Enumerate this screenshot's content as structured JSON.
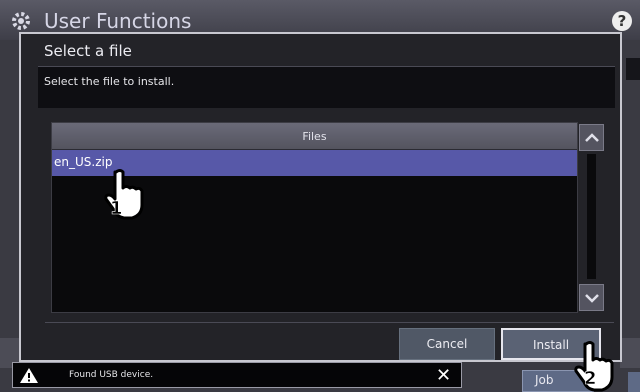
{
  "app": {
    "title": "User Functions",
    "help_label": "?"
  },
  "dialog": {
    "title": "Select a file",
    "message": "Select the file to install.",
    "list": {
      "column_header": "Files",
      "files": [
        "en_US.zip"
      ],
      "selected_index": 0
    },
    "cancel_label": "Cancel",
    "install_label": "Install"
  },
  "notification": {
    "text": "Found USB device.",
    "close_label": "✕"
  },
  "background": {
    "job_button_label": "Job"
  },
  "callouts": {
    "step_1": "1",
    "step_2": "2"
  },
  "colors": {
    "selected_row": "#5758a8",
    "dialog_bg": "#232328"
  }
}
